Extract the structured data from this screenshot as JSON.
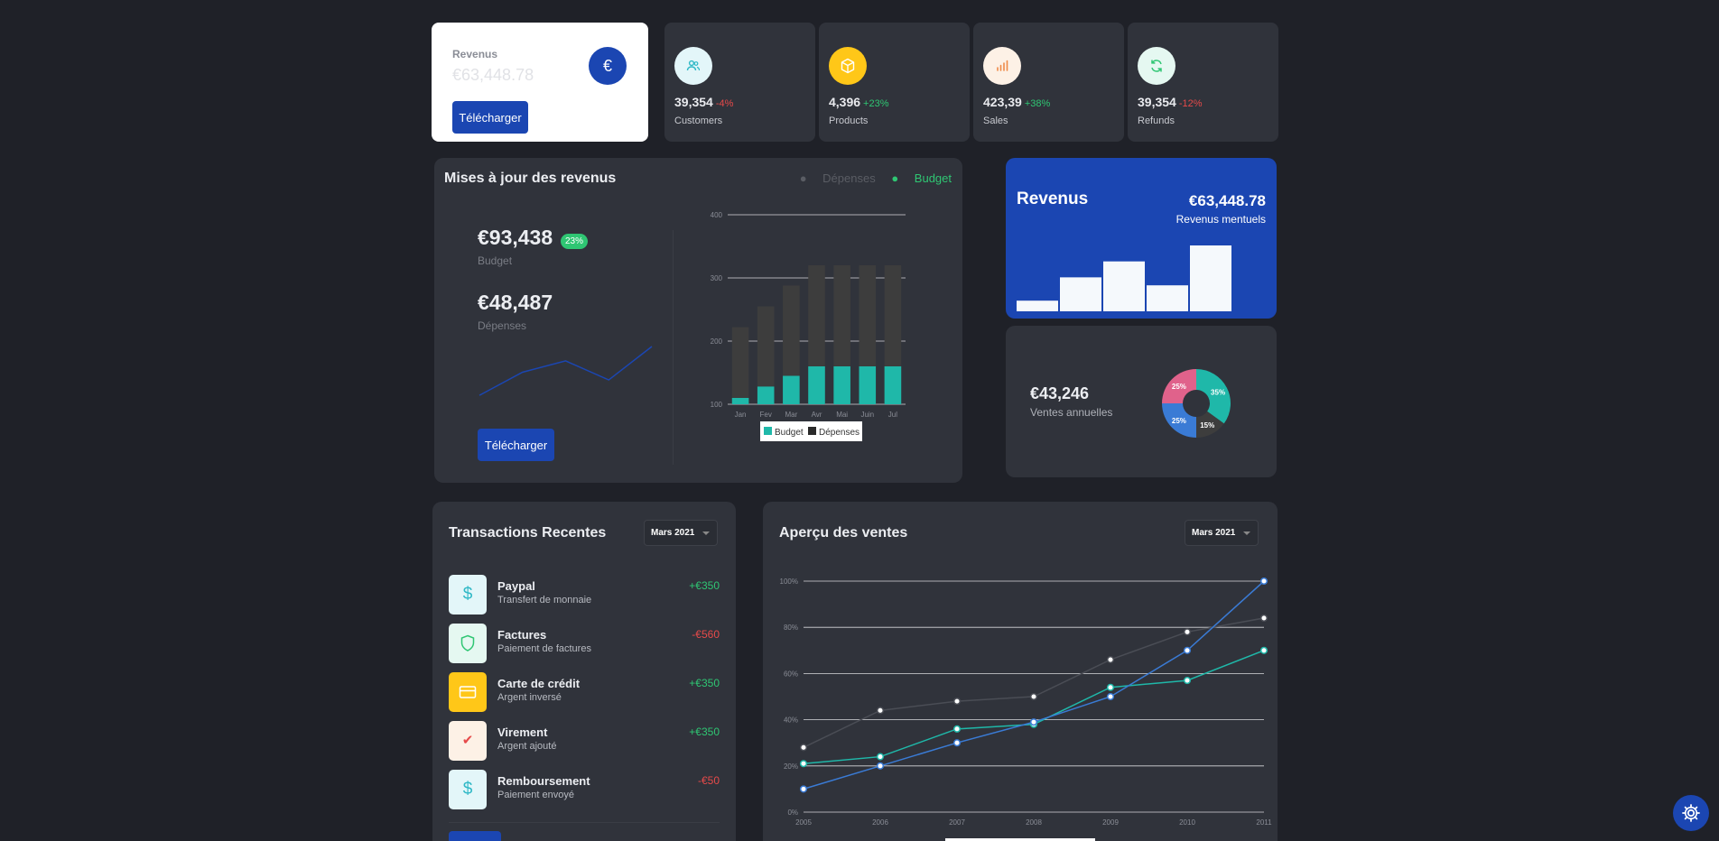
{
  "revenue_card": {
    "label": "Revenus",
    "value": "€63,448.78",
    "icon_symbol": "€",
    "button_label": "Télécharger"
  },
  "stats": [
    {
      "value": "39,354",
      "change": "-4%",
      "trend": "down",
      "label": "Customers",
      "icon": "users-icon",
      "icon_bg": "#e3f6f9",
      "icon_color": "#2fb8c6"
    },
    {
      "value": "4,396",
      "change": "+23%",
      "trend": "up",
      "label": "Products",
      "icon": "box-icon",
      "icon_bg": "#ffc718",
      "icon_color": "#ffffff"
    },
    {
      "value": "423,39",
      "change": "+38%",
      "trend": "up",
      "label": "Sales",
      "icon": "bar-chart-icon",
      "icon_bg": "#fdf1e6",
      "icon_color": "#ef8a48"
    },
    {
      "value": "39,354",
      "change": "-12%",
      "trend": "down",
      "label": "Refunds",
      "icon": "refresh-icon",
      "icon_bg": "#e5f8f1",
      "icon_color": "#2fc673"
    }
  ],
  "updates": {
    "title": "Mises à jour des revenus",
    "legend": [
      {
        "label": "Dépenses",
        "color": "#5a5d64"
      },
      {
        "label": "Budget",
        "color": "#2fc673"
      }
    ],
    "budget_value": "€93,438",
    "budget_badge": "23%",
    "budget_label": "Budget",
    "expenses_value": "€48,487",
    "expenses_label": "Dépenses",
    "button_label": "Télécharger",
    "sparkline": [
      0.05,
      0.5,
      0.72,
      0.35,
      1.0
    ]
  },
  "chart_data": [
    {
      "type": "bar",
      "categories": [
        "Jan",
        "Fev",
        "Mar",
        "Avr",
        "Mai",
        "Juin",
        "Jul"
      ],
      "ylim": [
        100,
        400
      ],
      "yticks": [
        100,
        200,
        300,
        400
      ],
      "series": [
        {
          "name": "Budget",
          "values": [
            110,
            128,
            145,
            160,
            160,
            160,
            160
          ],
          "color": "#1fb8a9"
        },
        {
          "name": "Dépenses",
          "values": [
            222,
            255,
            288,
            320,
            320,
            320,
            320
          ],
          "color": "#3d3d3d"
        }
      ],
      "legend": [
        "Budget",
        "Dépenses"
      ]
    },
    {
      "type": "bar",
      "values": [
        1.0,
        4.8,
        7.4,
        3.5,
        10.0
      ],
      "color": "#f5f9fc"
    },
    {
      "type": "pie",
      "slices": [
        {
          "label": "35%",
          "value": 35,
          "color": "#1fb8a9"
        },
        {
          "label": "15%",
          "value": 15,
          "color": "#3d3d3d"
        },
        {
          "label": "25%",
          "value": 25,
          "color": "#3a7bd5"
        },
        {
          "label": "25%",
          "value": 25,
          "color": "#e0628b"
        }
      ]
    },
    {
      "type": "line",
      "x": [
        "2005",
        "2006",
        "2007",
        "2008",
        "2009",
        "2010",
        "2011"
      ],
      "ylim": [
        0,
        100
      ],
      "yticks": [
        "0%",
        "20%",
        "40%",
        "60%",
        "80%",
        "100%"
      ],
      "series": [
        {
          "values": [
            28,
            44,
            48,
            50,
            66,
            78,
            84
          ],
          "color": "#4a4d55",
          "marker": "#ffffff"
        },
        {
          "values": [
            21,
            24,
            36,
            38,
            54,
            57,
            70
          ],
          "color": "#1fb8a9",
          "marker": "#ffffff"
        },
        {
          "values": [
            10,
            20,
            30,
            39,
            50,
            70,
            100
          ],
          "color": "#3a7bd5",
          "marker": "#ffffff"
        }
      ]
    }
  ],
  "blue_revenue": {
    "title": "Revenus",
    "amount": "€63,448.78",
    "subtitle": "Revenus mentuels"
  },
  "annual_sales": {
    "amount": "€43,246",
    "label": "Ventes annuelles"
  },
  "transactions": {
    "title": "Transactions Recentes",
    "period": "Mars 2021",
    "items": [
      {
        "name": "Paypal",
        "desc": "Transfert de monnaie",
        "amount": "+€350",
        "icon": "dollar-icon",
        "glyph": "$",
        "bg": "#e3f6f9",
        "fg": "#2fb8c6",
        "color": "#2fc673"
      },
      {
        "name": "Factures",
        "desc": "Paiement de factures",
        "amount": "-€560",
        "icon": "shield-icon",
        "glyph": "⛉",
        "bg": "#e5f8f1",
        "fg": "#2fc673",
        "color": "#e64a4a"
      },
      {
        "name": "Carte de crédit",
        "desc": "Argent inversé",
        "amount": "+€350",
        "icon": "credit-card-icon",
        "glyph": "▭",
        "bg": "#ffc718",
        "fg": "#ffffff",
        "color": "#2fc673"
      },
      {
        "name": "Virement",
        "desc": "Argent ajouté",
        "amount": "+€350",
        "icon": "check-icon",
        "glyph": "✔",
        "bg": "#fdf1e6",
        "fg": "#e64a4a",
        "color": "#2fc673"
      },
      {
        "name": "Remboursement",
        "desc": "Paiement envoyé",
        "amount": "-€50",
        "icon": "dollar-icon",
        "glyph": "$",
        "bg": "#e3f6f9",
        "fg": "#2fb8c6",
        "color": "#e64a4a"
      }
    ]
  },
  "overview": {
    "title": "Aperçu des ventes",
    "period": "Mars 2021"
  },
  "settings": {
    "icon": "gear-icon"
  }
}
